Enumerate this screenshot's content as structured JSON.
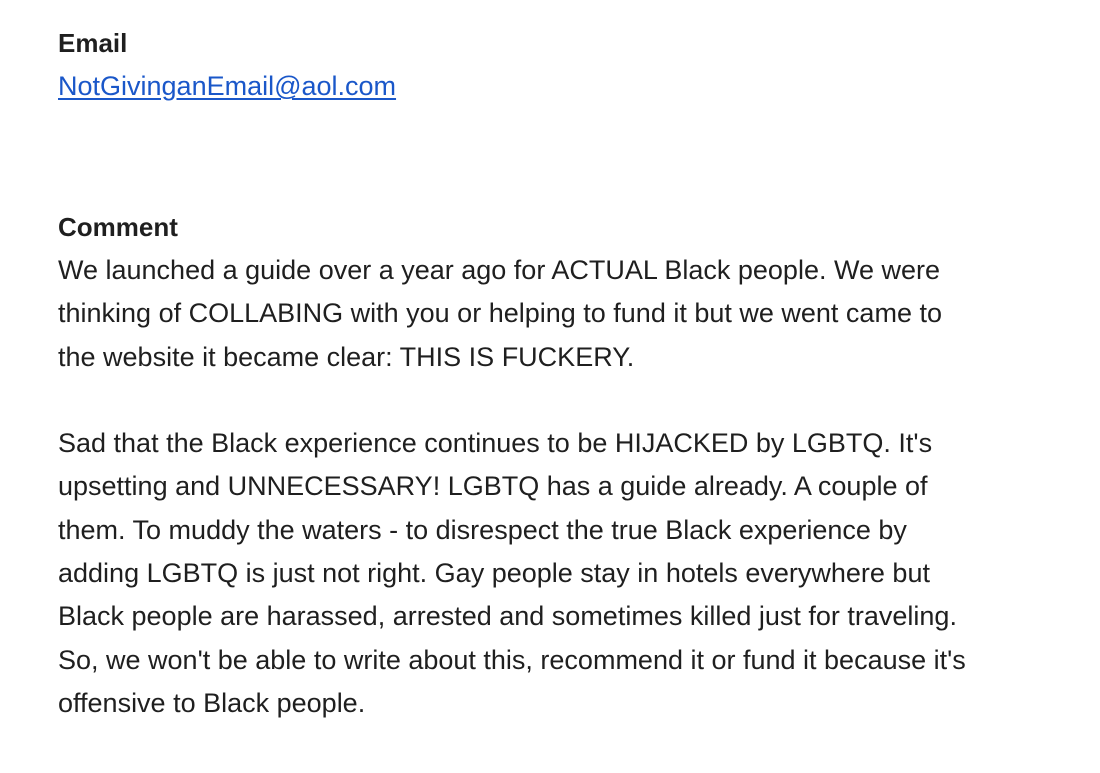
{
  "email": {
    "label": "Email",
    "value": "NotGivinganEmail@aol.com"
  },
  "comment": {
    "label": "Comment",
    "paragraphs": [
      {
        "lines": [
          "We launched a guide over a year ago for ACTUAL Black people. We were",
          "thinking of COLLABING with you or helping to fund it but we went came to",
          "the website it became clear: THIS IS FUCKERY."
        ]
      },
      {
        "lines": [
          "Sad that the Black experience continues to be HIJACKED by LGBTQ. It's",
          "upsetting and UNNECESSARY! LGBTQ has a guide already. A couple of",
          "them. To muddy the waters - to disrespect the true Black experience by",
          "adding LGBTQ is just not right. Gay people stay in hotels everywhere but",
          "Black people are harassed, arrested and sometimes killed just for traveling.",
          "So, we won't be able to write about this, recommend it or fund it because it's",
          "offensive to Black people."
        ]
      }
    ]
  }
}
